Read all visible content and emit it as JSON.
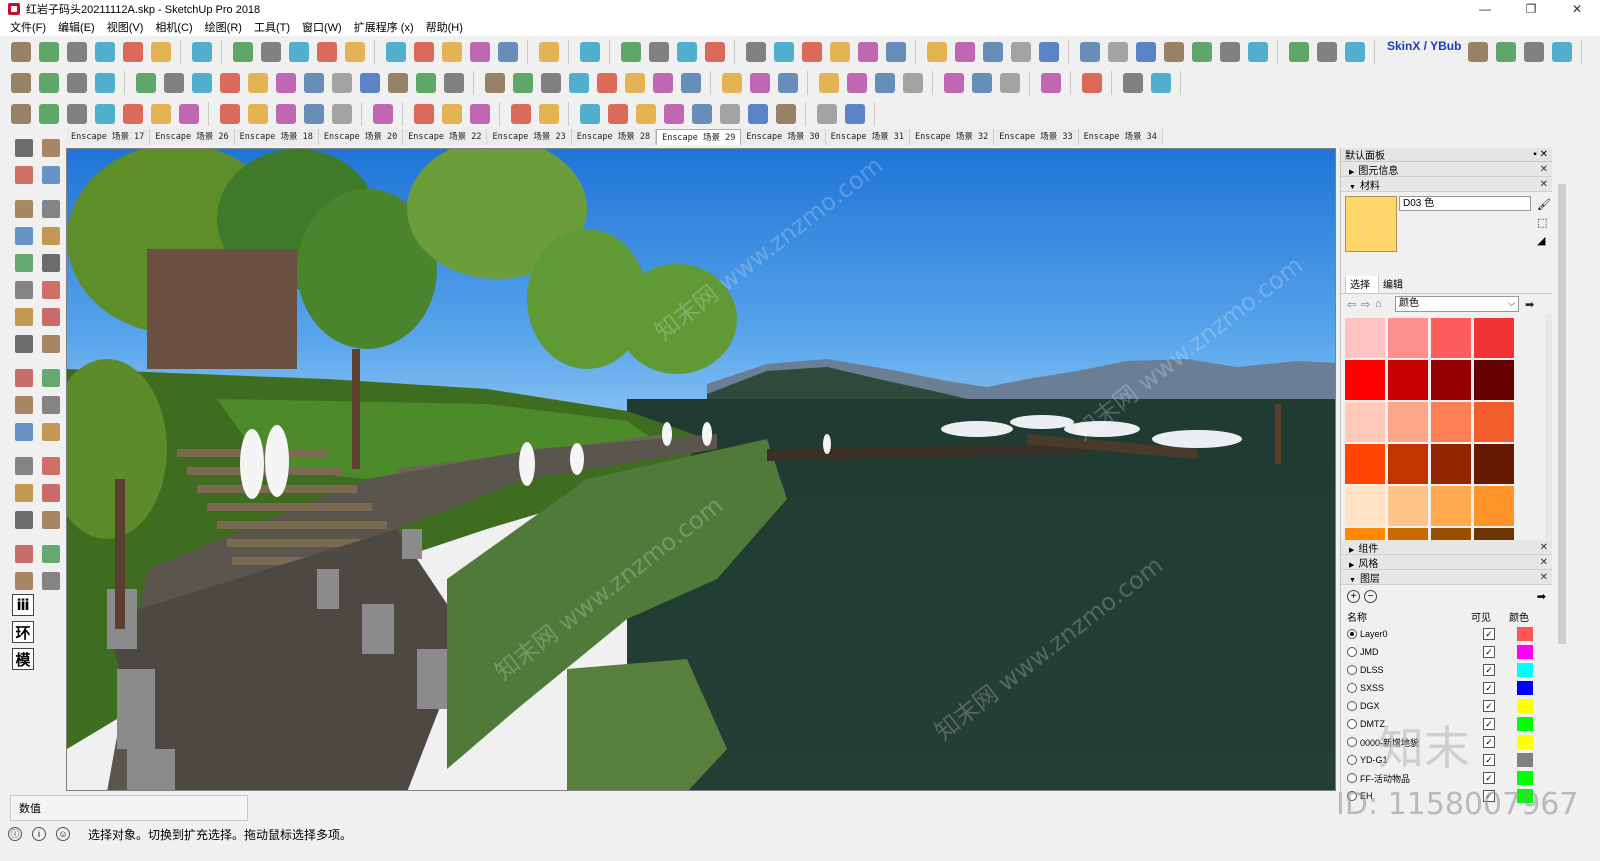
{
  "window": {
    "title": "红岩子码头20211112A.skp - SketchUp Pro 2018",
    "minimize": "—",
    "maximize": "❐",
    "close": "✕"
  },
  "menu": [
    "文件(F)",
    "编辑(E)",
    "视图(V)",
    "相机(C)",
    "绘图(R)",
    "工具(T)",
    "窗口(W)",
    "扩展程序 (x)",
    "帮助(H)"
  ],
  "toolbar": {
    "skinx_label": "SkinX / YBub"
  },
  "scene_tabs": [
    "Enscape 场景 17",
    "Enscape 场景 26",
    "Enscape 场景 18",
    "Enscape 场景 20",
    "Enscape 场景 22",
    "Enscape 场景 23",
    "Enscape 场景 28",
    "Enscape 场景 29",
    "Enscape 场景 30",
    "Enscape 场景 31",
    "Enscape 场景 32",
    "Enscape 场景 33",
    "Enscape 场景 34"
  ],
  "active_scene_index": 7,
  "left_toolbar": {
    "char_buttons": [
      "ⅲ",
      "环",
      "模"
    ]
  },
  "panel": {
    "title": "默认面板",
    "sections": {
      "entity_info": "图元信息",
      "materials": "材料",
      "components": "组件",
      "styles": "风格",
      "layers": "图层"
    },
    "material": {
      "name": "D03 色",
      "swatch_color": "#ffd66b",
      "tab_select": "选择",
      "tab_edit": "编辑",
      "library": "颜色"
    },
    "palette_colors": [
      "#ffc3c3",
      "#ff8e8e",
      "#ff5c5c",
      "#f03232",
      "#ff0000",
      "#c80000",
      "#960000",
      "#640000",
      "#ffcab8",
      "#ffa58a",
      "#ff7f55",
      "#f25d2c",
      "#ff4500",
      "#c43400",
      "#922600",
      "#661800",
      "#ffe3c4",
      "#ffc48a",
      "#ffa850",
      "#ff9428",
      "#ff8800",
      "#cc6a00",
      "#9a4e00",
      "#6a3500"
    ],
    "layers": {
      "col_name": "名称",
      "col_visible": "可见",
      "col_color": "颜色",
      "rows": [
        {
          "name": "Layer0",
          "active": true,
          "visible": true,
          "color": "#ff5555"
        },
        {
          "name": "JMD",
          "active": false,
          "visible": true,
          "color": "#ff00ff"
        },
        {
          "name": "DLSS",
          "active": false,
          "visible": true,
          "color": "#00ffff"
        },
        {
          "name": "SXSS",
          "active": false,
          "visible": true,
          "color": "#0000ff"
        },
        {
          "name": "DGX",
          "active": false,
          "visible": true,
          "color": "#ffff00"
        },
        {
          "name": "DMTZ",
          "active": false,
          "visible": true,
          "color": "#00ff00"
        },
        {
          "name": "0000-新增地貌",
          "active": false,
          "visible": true,
          "color": "#ffff00"
        },
        {
          "name": "YD-G1",
          "active": false,
          "visible": true,
          "color": "#808080"
        },
        {
          "name": "FF-活动物品",
          "active": false,
          "visible": true,
          "color": "#00ff00"
        },
        {
          "name": "EH",
          "active": false,
          "visible": true,
          "color": "#00ff00"
        }
      ]
    }
  },
  "value_label": "数值",
  "status_text": "选择对象。切换到扩充选择。拖动鼠标选择多项。",
  "watermark": {
    "site": "知末网 www.znzmo.com",
    "brand": "知末",
    "id": "ID: 1158007967"
  }
}
